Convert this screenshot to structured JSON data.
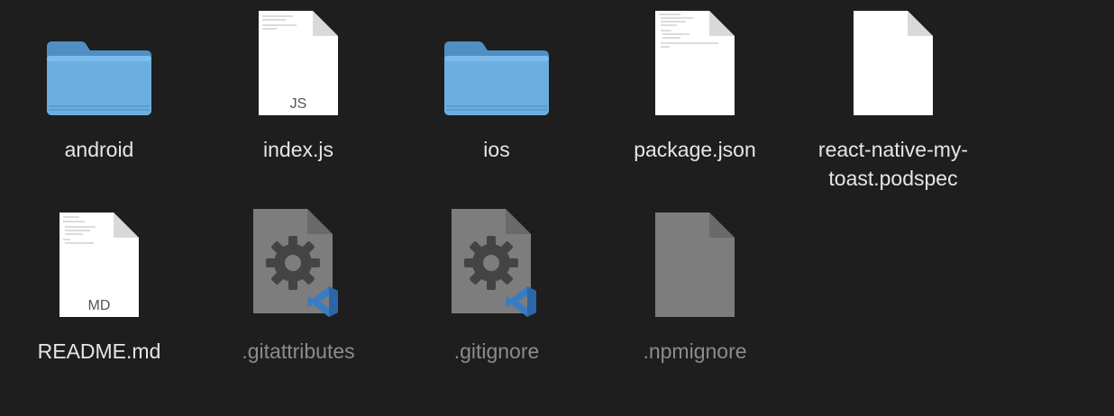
{
  "files": [
    {
      "name": "android",
      "kind": "folder",
      "icon": "folder-icon",
      "dim": false
    },
    {
      "name": "index.js",
      "kind": "document",
      "icon": "js-document-icon",
      "badge": "JS",
      "dim": false
    },
    {
      "name": "ios",
      "kind": "folder",
      "icon": "folder-icon",
      "dim": false
    },
    {
      "name": "package.json",
      "kind": "document",
      "icon": "json-document-icon",
      "dim": false
    },
    {
      "name": "react-native-my-toast.podspec",
      "display": "react-native-my-\ntoast.podspec",
      "kind": "document",
      "icon": "blank-document-icon",
      "dim": false
    },
    {
      "name": "README.md",
      "kind": "document",
      "icon": "md-document-icon",
      "badge": "MD",
      "dim": false
    },
    {
      "name": ".gitattributes",
      "kind": "vscode-config",
      "icon": "vscode-settings-icon",
      "dim": true
    },
    {
      "name": ".gitignore",
      "kind": "vscode-config",
      "icon": "vscode-settings-icon",
      "dim": true
    },
    {
      "name": ".npmignore",
      "kind": "hidden-document",
      "icon": "hidden-document-icon",
      "dim": true
    }
  ],
  "colors": {
    "background": "#1e1e1e",
    "folder": "#6aafe0",
    "label": "#e6e6e6",
    "label_dim": "#8c8c8c",
    "vscode_blue": "#3a7cc2"
  }
}
